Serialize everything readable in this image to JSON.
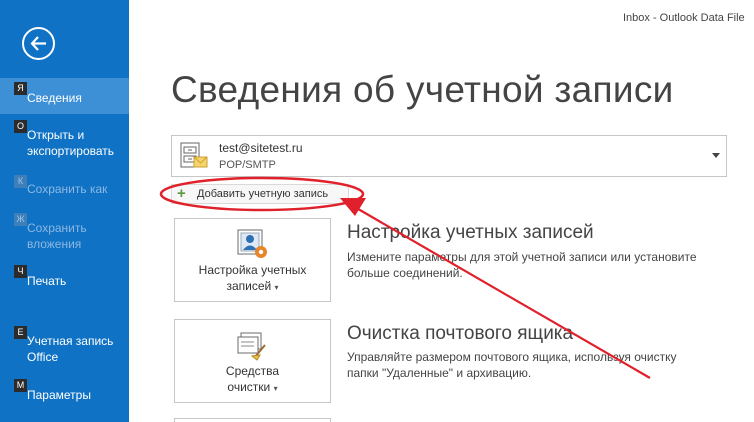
{
  "window_title": "Inbox - Outlook Data File",
  "page_title": "Сведения об учетной записи",
  "sidebar": {
    "items": [
      {
        "key": "Я",
        "label": "Сведения",
        "state": "active"
      },
      {
        "key": "О",
        "label": "Открыть и\nэкспортировать",
        "state": "normal"
      },
      {
        "key": "К",
        "label": "Сохранить как",
        "state": "disabled"
      },
      {
        "key": "Ж",
        "label": "Сохранить\nвложения",
        "state": "disabled"
      },
      {
        "key": "Ч",
        "label": "Печать",
        "state": "normal"
      },
      {
        "key": "Е",
        "label": "Учетная запись\nOffice",
        "state": "normal"
      },
      {
        "key": "М",
        "label": "Параметры",
        "state": "normal"
      }
    ]
  },
  "account": {
    "email": "test@sitetest.ru",
    "type": "POP/SMTP"
  },
  "add_account_label": "Добавить учетную запись",
  "sections": [
    {
      "button_label_line1": "Настройка учетных",
      "button_label_line2": "записей",
      "title": "Настройка учетных записей",
      "description": "Измените параметры для этой учетной записи или установите больше соединений."
    },
    {
      "button_label_line1": "Средства",
      "button_label_line2": "очистки",
      "title": "Очистка почтового ящика",
      "description": "Управляйте размером почтового ящика, используя очистку папки \"Удаленные\" и архивацию."
    }
  ],
  "colors": {
    "sidebar": "#0f72c4",
    "sidebar_active": "#3d8fd6",
    "annotation": "#e0202a"
  },
  "icons": {
    "back": "back-arrow-icon",
    "account": "file-cabinet-envelope-icon",
    "add": "plus-icon",
    "account_settings": "account-settings-icon",
    "cleanup": "cleanup-tools-icon"
  }
}
